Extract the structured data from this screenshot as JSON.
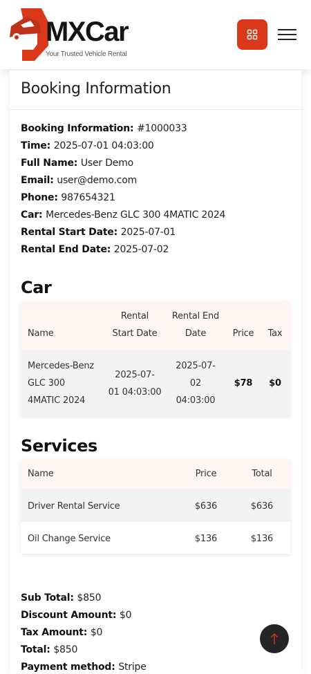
{
  "brand": {
    "name": "MXCar",
    "tagline": "Your Trusted Vehicle Rental",
    "accent": "#d9391a"
  },
  "header": {
    "grid_icon": "grid-icon",
    "menu_icon": "hamburger-icon"
  },
  "page": {
    "title": "Booking Information"
  },
  "booking": [
    {
      "label": "Booking Information",
      "value": "#1000033"
    },
    {
      "label": "Time",
      "value": "2025-07-01 04:03:00"
    },
    {
      "label": "Full Name",
      "value": "User Demo"
    },
    {
      "label": "Email",
      "value": "user@demo.com"
    },
    {
      "label": "Phone",
      "value": "987654321"
    },
    {
      "label": "Car",
      "value": "Mercedes-Benz GLC 300 4MATIC 2024"
    },
    {
      "label": "Rental Start Date",
      "value": "2025-07-01"
    },
    {
      "label": "Rental End Date",
      "value": "2025-07-02"
    }
  ],
  "car_section": {
    "title": "Car",
    "headers": {
      "name": "Name",
      "start_1": "Rental",
      "start_2": "Start Date",
      "end_1": "Rental End",
      "end_2": "Date",
      "price": "Price",
      "tax": "Tax"
    },
    "row": {
      "name_1": "Mercedes-Benz",
      "name_2": "GLC 300",
      "name_3": "4MATIC 2024",
      "start_1": "2025-07-",
      "start_2": "01 04:03:00",
      "end_1": "2025-07-",
      "end_2": "02",
      "end_3": "04:03:00",
      "price": "$78",
      "tax": "$0"
    }
  },
  "services_section": {
    "title": "Services",
    "headers": {
      "name": "Name",
      "price": "Price",
      "total": "Total"
    },
    "rows": [
      {
        "name": "Driver Rental Service",
        "price": "$636",
        "total": "$636"
      },
      {
        "name": "Oil Change Service",
        "price": "$136",
        "total": "$136"
      }
    ]
  },
  "totals": [
    {
      "label": "Sub Total",
      "value": "$850"
    },
    {
      "label": "Discount Amount",
      "value": "$0"
    },
    {
      "label": "Tax Amount",
      "value": "$0"
    },
    {
      "label": "Total",
      "value": "$850"
    },
    {
      "label": "Payment method",
      "value": "Stripe"
    }
  ],
  "scroll_top_icon": "arrow-up-icon"
}
